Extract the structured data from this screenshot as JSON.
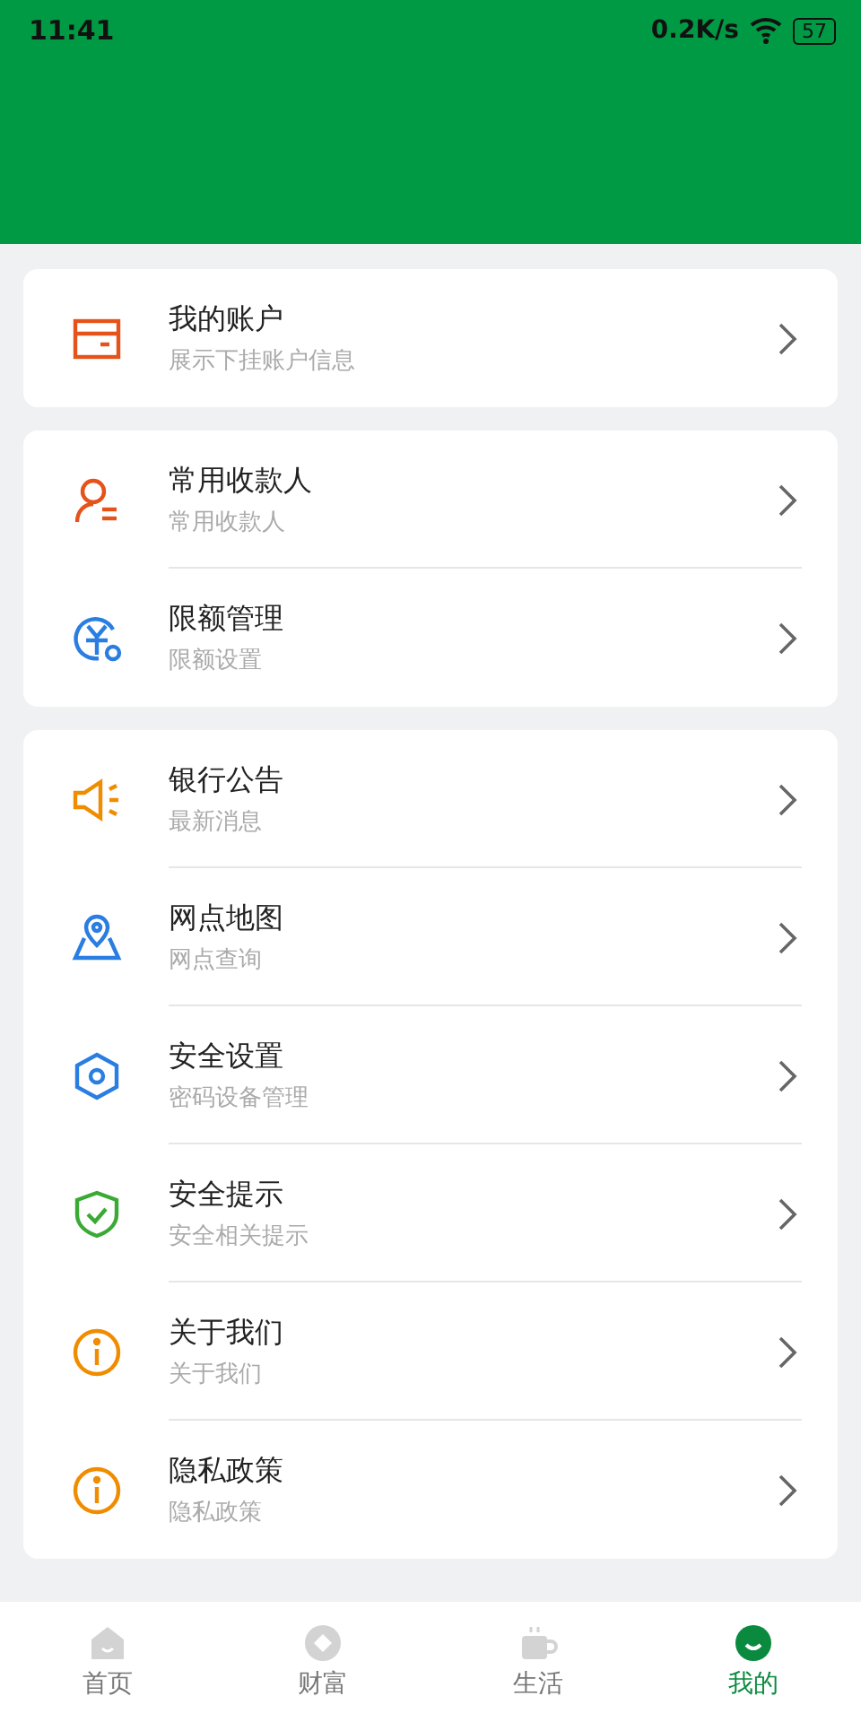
{
  "status_bar": {
    "time": "11:41",
    "speed": "0.2K/s",
    "battery": "57"
  },
  "groups": [
    {
      "items": [
        {
          "kind": "card",
          "title": "我的账户",
          "subtitle": "展示下挂账户信息"
        }
      ]
    },
    {
      "items": [
        {
          "kind": "payee",
          "title": "常用收款人",
          "subtitle": "常用收款人"
        },
        {
          "kind": "limit",
          "title": "限额管理",
          "subtitle": "限额设置"
        }
      ]
    },
    {
      "items": [
        {
          "kind": "speaker",
          "title": "银行公告",
          "subtitle": "最新消息"
        },
        {
          "kind": "map",
          "title": "网点地图",
          "subtitle": "网点查询"
        },
        {
          "kind": "hexagon",
          "title": "安全设置",
          "subtitle": "密码设备管理"
        },
        {
          "kind": "shield",
          "title": "安全提示",
          "subtitle": "安全相关提示"
        },
        {
          "kind": "info",
          "title": "关于我们",
          "subtitle": "关于我们"
        },
        {
          "kind": "info",
          "title": "隐私政策",
          "subtitle": "隐私政策"
        }
      ]
    }
  ],
  "tabs": [
    {
      "kind": "home",
      "label": "首页",
      "selected": false
    },
    {
      "kind": "wealth",
      "label": "财富",
      "selected": false
    },
    {
      "kind": "life",
      "label": "生活",
      "selected": false
    },
    {
      "kind": "mine",
      "label": "我的",
      "selected": true
    }
  ]
}
